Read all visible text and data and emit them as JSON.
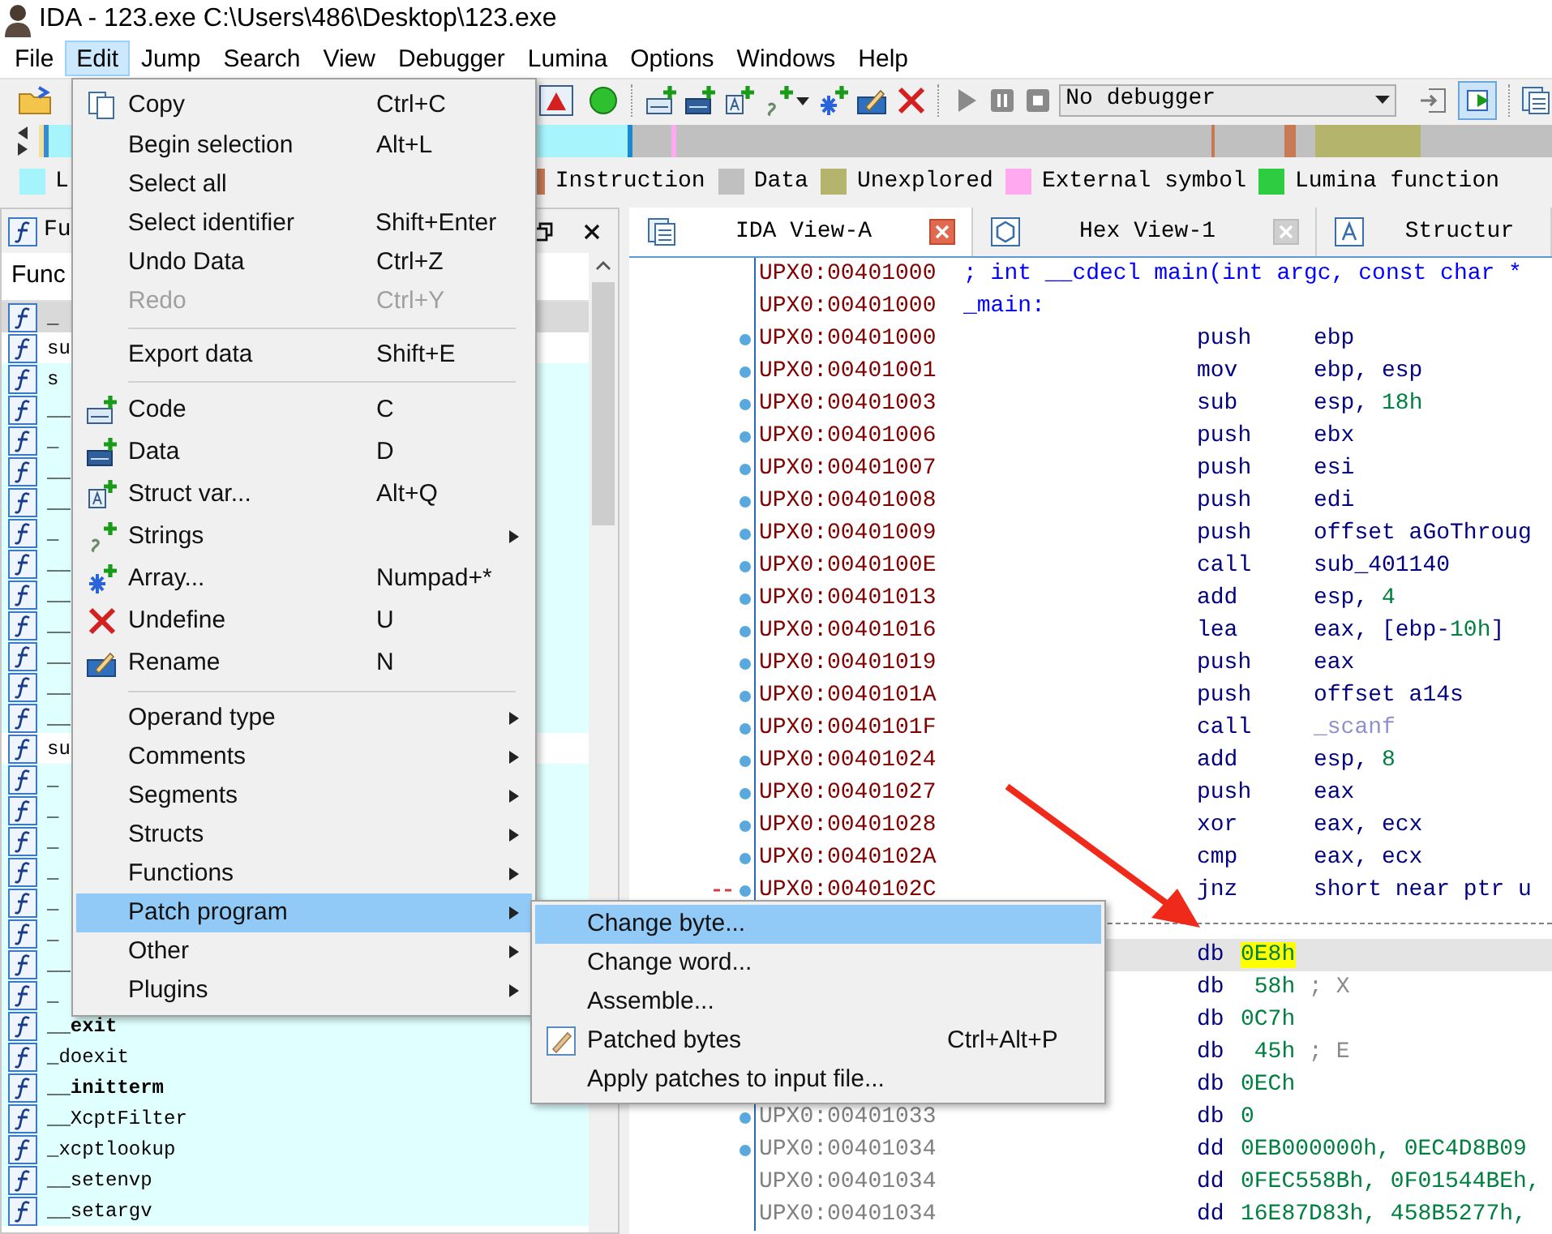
{
  "window": {
    "title": "IDA - 123.exe C:\\Users\\486\\Desktop\\123.exe"
  },
  "menu_bar": [
    {
      "label": "File",
      "selected": false
    },
    {
      "label": "Edit",
      "selected": true
    },
    {
      "label": "Jump",
      "selected": false
    },
    {
      "label": "Search",
      "selected": false
    },
    {
      "label": "View",
      "selected": false
    },
    {
      "label": "Debugger",
      "selected": false
    },
    {
      "label": "Lumina",
      "selected": false
    },
    {
      "label": "Options",
      "selected": false
    },
    {
      "label": "Windows",
      "selected": false
    },
    {
      "label": "Help",
      "selected": false
    }
  ],
  "toolbar": {
    "debugger_select": {
      "value": "No debugger"
    }
  },
  "legend": [
    {
      "label": "L",
      "color": "#a6f4fb"
    },
    {
      "label": "Instruction",
      "color": "#c87a55"
    },
    {
      "label": "Data",
      "color": "#c0c0c0"
    },
    {
      "label": "Unexplored",
      "color": "#b4b46c"
    },
    {
      "label": "External symbol",
      "color": "#ffaaf0"
    },
    {
      "label": "Lumina function",
      "color": "#2ecc40"
    }
  ],
  "functions_pane": {
    "title": "Fu",
    "column": "Func",
    "rows": [
      {
        "name": "_",
        "selected": true,
        "library": false,
        "bold": false
      },
      {
        "name": "su",
        "selected": false,
        "library": false,
        "bold": false
      },
      {
        "name": "s",
        "selected": false,
        "library": true,
        "bold": false
      },
      {
        "name": "__",
        "selected": false,
        "library": true,
        "bold": false
      },
      {
        "name": "_",
        "selected": false,
        "library": true,
        "bold": false
      },
      {
        "name": "__",
        "selected": false,
        "library": true,
        "bold": false
      },
      {
        "name": "__",
        "selected": false,
        "library": true,
        "bold": false
      },
      {
        "name": "_",
        "selected": false,
        "library": true,
        "bold": false
      },
      {
        "name": "__",
        "selected": false,
        "library": true,
        "bold": false
      },
      {
        "name": "__",
        "selected": false,
        "library": true,
        "bold": false
      },
      {
        "name": "__",
        "selected": false,
        "library": true,
        "bold": false
      },
      {
        "name": "__",
        "selected": false,
        "library": true,
        "bold": false
      },
      {
        "name": "__",
        "selected": false,
        "library": true,
        "bold": false
      },
      {
        "name": "__",
        "selected": false,
        "library": true,
        "bold": false
      },
      {
        "name": "su",
        "selected": false,
        "library": false,
        "bold": false
      },
      {
        "name": "_",
        "selected": false,
        "library": true,
        "bold": false
      },
      {
        "name": "_",
        "selected": false,
        "library": true,
        "bold": false
      },
      {
        "name": "_",
        "selected": false,
        "library": true,
        "bold": false
      },
      {
        "name": "_",
        "selected": false,
        "library": true,
        "bold": false
      },
      {
        "name": "_",
        "selected": false,
        "library": true,
        "bold": false
      },
      {
        "name": "_",
        "selected": false,
        "library": true,
        "bold": false
      },
      {
        "name": "__",
        "selected": false,
        "library": true,
        "bold": false
      },
      {
        "name": "_",
        "selected": false,
        "library": true,
        "bold": false
      },
      {
        "name": "__exit",
        "selected": false,
        "library": true,
        "bold": true
      },
      {
        "name": "_doexit",
        "selected": false,
        "library": true,
        "bold": false
      },
      {
        "name": "__initterm",
        "selected": false,
        "library": true,
        "bold": true
      },
      {
        "name": "__XcptFilter",
        "selected": false,
        "library": true,
        "bold": false
      },
      {
        "name": "_xcptlookup",
        "selected": false,
        "library": true,
        "bold": false
      },
      {
        "name": "__setenvp",
        "selected": false,
        "library": true,
        "bold": false
      },
      {
        "name": "__setargv",
        "selected": false,
        "library": true,
        "bold": false
      }
    ]
  },
  "tabs": [
    {
      "label": "IDA View-A",
      "selected": true,
      "closable": true
    },
    {
      "label": "Hex View-1",
      "selected": false,
      "closable": true
    },
    {
      "label": "Structur",
      "selected": false,
      "closable": false
    }
  ],
  "listing": [
    {
      "kind": "comment",
      "address": "UPX0:00401000",
      "text": "; int __cdecl main(int argc, const char *",
      "dot": false,
      "branch": false,
      "selected": false
    },
    {
      "kind": "label",
      "address": "UPX0:00401000",
      "text": "_main:",
      "dot": false,
      "branch": false,
      "selected": false
    },
    {
      "kind": "insn",
      "address": "UPX0:00401000",
      "mnemonic": "push",
      "operands": [
        {
          "text": "ebp",
          "kind": "reg"
        }
      ],
      "dot": true,
      "branch": false,
      "selected": false
    },
    {
      "kind": "insn",
      "address": "UPX0:00401001",
      "mnemonic": "mov",
      "operands": [
        {
          "text": "ebp, esp",
          "kind": "reg"
        }
      ],
      "dot": true,
      "branch": false,
      "selected": false
    },
    {
      "kind": "insn",
      "address": "UPX0:00401003",
      "mnemonic": "sub",
      "operands": [
        {
          "text": "esp, ",
          "kind": "reg"
        },
        {
          "text": "18h",
          "kind": "num"
        }
      ],
      "dot": true,
      "branch": false,
      "selected": false
    },
    {
      "kind": "insn",
      "address": "UPX0:00401006",
      "mnemonic": "push",
      "operands": [
        {
          "text": "ebx",
          "kind": "reg"
        }
      ],
      "dot": true,
      "branch": false,
      "selected": false
    },
    {
      "kind": "insn",
      "address": "UPX0:00401007",
      "mnemonic": "push",
      "operands": [
        {
          "text": "esi",
          "kind": "reg"
        }
      ],
      "dot": true,
      "branch": false,
      "selected": false
    },
    {
      "kind": "insn",
      "address": "UPX0:00401008",
      "mnemonic": "push",
      "operands": [
        {
          "text": "edi",
          "kind": "reg"
        }
      ],
      "dot": true,
      "branch": false,
      "selected": false
    },
    {
      "kind": "insn",
      "address": "UPX0:00401009",
      "mnemonic": "push",
      "operands": [
        {
          "text": "offset aGoThroug",
          "kind": "reg"
        }
      ],
      "dot": true,
      "branch": false,
      "selected": false
    },
    {
      "kind": "insn",
      "address": "UPX0:0040100E",
      "mnemonic": "call",
      "operands": [
        {
          "text": "sub_401140",
          "kind": "reg"
        }
      ],
      "dot": true,
      "branch": false,
      "selected": false
    },
    {
      "kind": "insn",
      "address": "UPX0:00401013",
      "mnemonic": "add",
      "operands": [
        {
          "text": "esp, ",
          "kind": "reg"
        },
        {
          "text": "4",
          "kind": "num"
        }
      ],
      "dot": true,
      "branch": false,
      "selected": false
    },
    {
      "kind": "insn",
      "address": "UPX0:00401016",
      "mnemonic": "lea",
      "operands": [
        {
          "text": "eax, [ebp-",
          "kind": "reg"
        },
        {
          "text": "10h",
          "kind": "num"
        },
        {
          "text": "]",
          "kind": "reg"
        }
      ],
      "dot": true,
      "branch": false,
      "selected": false
    },
    {
      "kind": "insn",
      "address": "UPX0:00401019",
      "mnemonic": "push",
      "operands": [
        {
          "text": "eax",
          "kind": "reg"
        }
      ],
      "dot": true,
      "branch": false,
      "selected": false
    },
    {
      "kind": "insn",
      "address": "UPX0:0040101A",
      "mnemonic": "push",
      "operands": [
        {
          "text": "offset a14s",
          "kind": "reg"
        }
      ],
      "dot": true,
      "branch": false,
      "selected": false
    },
    {
      "kind": "insn",
      "address": "UPX0:0040101F",
      "mnemonic": "call",
      "operands": [
        {
          "text": "_scanf",
          "kind": "ref"
        }
      ],
      "dot": true,
      "branch": false,
      "selected": false
    },
    {
      "kind": "insn",
      "address": "UPX0:00401024",
      "mnemonic": "add",
      "operands": [
        {
          "text": "esp, ",
          "kind": "reg"
        },
        {
          "text": "8",
          "kind": "num"
        }
      ],
      "dot": true,
      "branch": false,
      "selected": false
    },
    {
      "kind": "insn",
      "address": "UPX0:00401027",
      "mnemonic": "push",
      "operands": [
        {
          "text": "eax",
          "kind": "reg"
        }
      ],
      "dot": true,
      "branch": false,
      "selected": false
    },
    {
      "kind": "insn",
      "address": "UPX0:00401028",
      "mnemonic": "xor",
      "operands": [
        {
          "text": "eax, ecx",
          "kind": "reg"
        }
      ],
      "dot": true,
      "branch": false,
      "selected": false
    },
    {
      "kind": "insn",
      "address": "UPX0:0040102A",
      "mnemonic": "cmp",
      "operands": [
        {
          "text": "eax, ecx",
          "kind": "reg"
        }
      ],
      "dot": true,
      "branch": false,
      "selected": false
    },
    {
      "kind": "insn",
      "address": "UPX0:0040102C",
      "mnemonic": "jnz",
      "operands": [
        {
          "text": "short near ptr u",
          "kind": "reg"
        }
      ],
      "dot": true,
      "branch": true,
      "selected": false
    },
    {
      "kind": "separator"
    },
    {
      "kind": "data",
      "mnemonic": "db",
      "operands": [
        {
          "text": "0E8h",
          "kind": "hl"
        }
      ],
      "selected": true
    },
    {
      "kind": "data",
      "mnemonic": "db",
      "operands": [
        {
          "text": " 58h",
          "kind": "num"
        },
        {
          "text": " ; X",
          "kind": "comment"
        }
      ],
      "selected": false
    },
    {
      "kind": "data",
      "mnemonic": "db",
      "operands": [
        {
          "text": "0C7h",
          "kind": "num"
        }
      ],
      "selected": false
    },
    {
      "kind": "data",
      "mnemonic": "db",
      "operands": [
        {
          "text": " 45h",
          "kind": "num"
        },
        {
          "text": " ; E",
          "kind": "comment"
        }
      ],
      "selected": false
    },
    {
      "kind": "data",
      "mnemonic": "db",
      "operands": [
        {
          "text": "0ECh",
          "kind": "num"
        }
      ],
      "selected": false
    },
    {
      "kind": "data",
      "address": "UPX0:00401033",
      "mnemonic": "db",
      "operands": [
        {
          "text": "0",
          "kind": "num"
        }
      ],
      "dot": true,
      "branch": false,
      "selected": false
    },
    {
      "kind": "data",
      "address": "UPX0:00401034",
      "mnemonic": "dd",
      "operands": [
        {
          "text": "0EB000000h, 0EC4D8B09",
          "kind": "num"
        }
      ],
      "dot": true,
      "branch": false,
      "selected": false
    },
    {
      "kind": "data",
      "address": "UPX0:00401034",
      "mnemonic": "dd",
      "operands": [
        {
          "text": "0FEC558Bh, 0F01544BEh,",
          "kind": "num"
        }
      ],
      "dot": false,
      "branch": false,
      "selected": false
    },
    {
      "kind": "data",
      "address": "UPX0:00401034",
      "mnemonic": "dd",
      "operands": [
        {
          "text": "16E87D83h, 458B5277h,",
          "kind": "num"
        }
      ],
      "dot": false,
      "branch": false,
      "selected": false
    }
  ],
  "edit_menu": {
    "items": [
      {
        "kind": "item",
        "label": "Copy",
        "shortcut": "Ctrl+C",
        "submenu": false,
        "disabled": false,
        "selected": false
      },
      {
        "kind": "item",
        "label": "Begin selection",
        "shortcut": "Alt+L",
        "submenu": false,
        "disabled": false,
        "selected": false
      },
      {
        "kind": "item",
        "label": "Select all",
        "submenu": false,
        "disabled": false,
        "selected": false
      },
      {
        "kind": "item",
        "label": "Select identifier",
        "shortcut": "Shift+Enter",
        "submenu": false,
        "disabled": false,
        "selected": false
      },
      {
        "kind": "item",
        "label": "Undo Data",
        "shortcut": "Ctrl+Z",
        "submenu": false,
        "disabled": false,
        "selected": false
      },
      {
        "kind": "item",
        "label": "Redo",
        "shortcut": "Ctrl+Y",
        "submenu": false,
        "disabled": true,
        "selected": false
      },
      {
        "kind": "separator"
      },
      {
        "kind": "item",
        "label": "Export data",
        "shortcut": "Shift+E",
        "submenu": false,
        "disabled": false,
        "selected": false
      },
      {
        "kind": "separator"
      },
      {
        "kind": "item",
        "label": "Code",
        "shortcut": "C",
        "submenu": false,
        "disabled": false,
        "selected": false
      },
      {
        "kind": "item",
        "label": "Data",
        "shortcut": "D",
        "submenu": false,
        "disabled": false,
        "selected": false
      },
      {
        "kind": "item",
        "label": "Struct var...",
        "shortcut": "Alt+Q",
        "submenu": false,
        "disabled": false,
        "selected": false
      },
      {
        "kind": "item",
        "label": "Strings",
        "submenu": true,
        "disabled": false,
        "selected": false
      },
      {
        "kind": "item",
        "label": "Array...",
        "shortcut": "Numpad+*",
        "submenu": false,
        "disabled": false,
        "selected": false
      },
      {
        "kind": "item",
        "label": "Undefine",
        "shortcut": "U",
        "submenu": false,
        "disabled": false,
        "selected": false
      },
      {
        "kind": "item",
        "label": "Rename",
        "shortcut": "N",
        "submenu": false,
        "disabled": false,
        "selected": false
      },
      {
        "kind": "separator"
      },
      {
        "kind": "item",
        "label": "Operand type",
        "submenu": true,
        "disabled": false,
        "selected": false
      },
      {
        "kind": "item",
        "label": "Comments",
        "submenu": true,
        "disabled": false,
        "selected": false
      },
      {
        "kind": "item",
        "label": "Segments",
        "submenu": true,
        "disabled": false,
        "selected": false
      },
      {
        "kind": "item",
        "label": "Structs",
        "submenu": true,
        "disabled": false,
        "selected": false
      },
      {
        "kind": "item",
        "label": "Functions",
        "submenu": true,
        "disabled": false,
        "selected": false
      },
      {
        "kind": "item",
        "label": "Patch program",
        "submenu": true,
        "disabled": false,
        "selected": true
      },
      {
        "kind": "item",
        "label": "Other",
        "submenu": true,
        "disabled": false,
        "selected": false
      },
      {
        "kind": "item",
        "label": "Plugins",
        "submenu": true,
        "disabled": false,
        "selected": false
      }
    ]
  },
  "patch_submenu": {
    "items": [
      {
        "label": "Change byte...",
        "submenu": false,
        "disabled": false,
        "selected": true
      },
      {
        "label": "Change word...",
        "submenu": false,
        "disabled": false,
        "selected": false
      },
      {
        "label": "Assemble...",
        "submenu": false,
        "disabled": false,
        "selected": false
      },
      {
        "label": "Patched bytes",
        "shortcut": "Ctrl+Alt+P",
        "submenu": false,
        "disabled": false,
        "selected": false
      },
      {
        "label": "Apply patches to input file...",
        "submenu": false,
        "disabled": false,
        "selected": false
      }
    ]
  }
}
